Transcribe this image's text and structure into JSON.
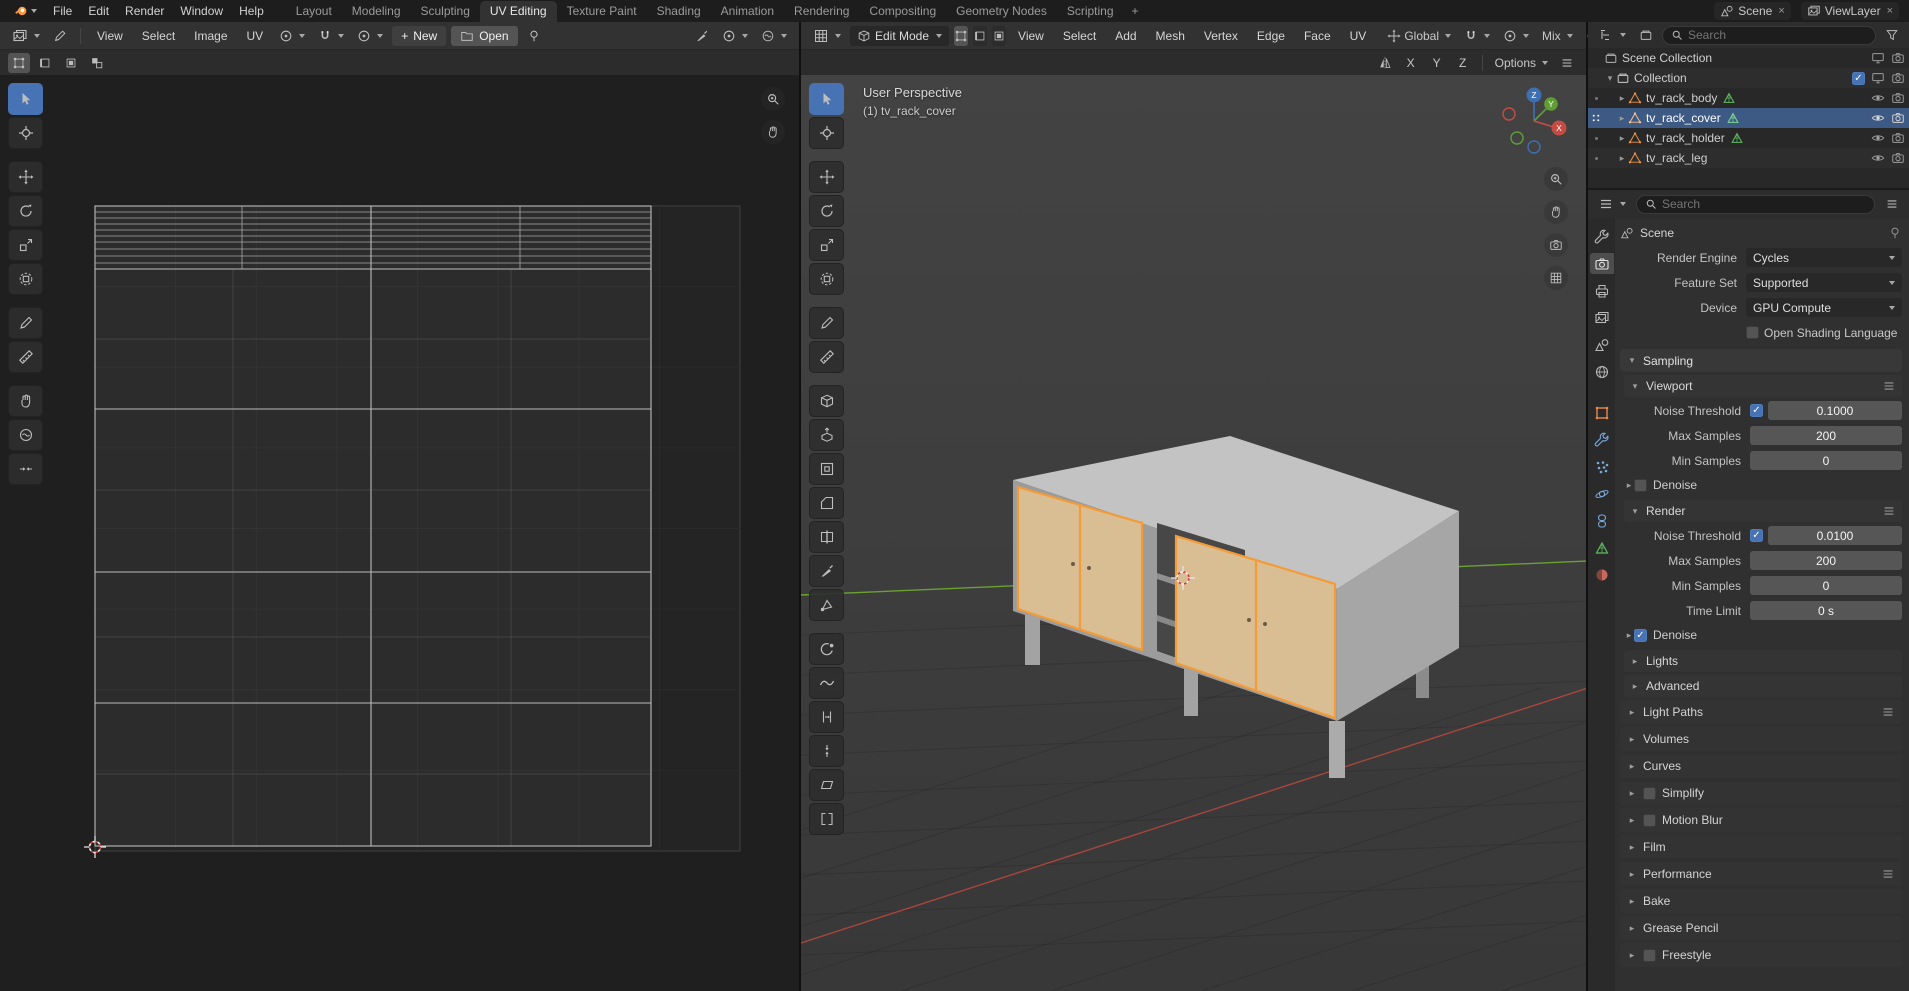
{
  "topbar": {
    "menus": [
      "File",
      "Edit",
      "Render",
      "Window",
      "Help"
    ],
    "tabs": [
      "Layout",
      "Modeling",
      "Sculpting",
      "UV Editing",
      "Texture Paint",
      "Shading",
      "Animation",
      "Rendering",
      "Compositing",
      "Geometry Nodes",
      "Scripting"
    ],
    "add_tab": "+",
    "scene_label": "Scene",
    "viewlayer_label": "ViewLayer",
    "close_glyph": "×"
  },
  "uv": {
    "menus": [
      "View",
      "Select",
      "Image",
      "UV"
    ],
    "new_label": "New",
    "new_plus": "+",
    "open_label": "Open",
    "tools": [
      "tweak-select",
      "cursor",
      "move",
      "rotate",
      "scale",
      "transform",
      "annotate",
      "measure",
      "grab",
      "relax",
      "pinch"
    ]
  },
  "vp": {
    "mode": "Edit Mode",
    "menus": [
      "View",
      "Select",
      "Add",
      "Mesh",
      "Vertex",
      "Edge",
      "Face",
      "UV"
    ],
    "orientation": "Global",
    "falloff": "Mix",
    "mirror_x": "X",
    "mirror_y": "Y",
    "mirror_z": "Z",
    "options": "Options",
    "overlay_line1": "User Perspective",
    "overlay_line2": "(1) tv_rack_cover",
    "gizmo_x": "X",
    "gizmo_y": "Y",
    "gizmo_z": "Z",
    "tools": [
      "tweak-select",
      "cursor",
      "move",
      "rotate",
      "scale",
      "transform",
      "annotate",
      "measure",
      "add-cube",
      "extrude-region",
      "inset-faces",
      "bevel",
      "loop-cut",
      "knife",
      "poly-build",
      "spin",
      "smooth",
      "edge-slide",
      "shrink-fatten",
      "shear",
      "rip-region"
    ]
  },
  "outliner": {
    "search_placeholder": "Search",
    "scene_collection": "Scene Collection",
    "collection": "Collection",
    "objects": [
      {
        "name": "tv_rack_body"
      },
      {
        "name": "tv_rack_cover",
        "active": true
      },
      {
        "name": "tv_rack_holder"
      },
      {
        "name": "tv_rack_leg"
      }
    ]
  },
  "props": {
    "search_placeholder": "Search",
    "breadcrumb": "Scene",
    "render_engine_label": "Render Engine",
    "render_engine_value": "Cycles",
    "feature_set_label": "Feature Set",
    "feature_set_value": "Supported",
    "device_label": "Device",
    "device_value": "GPU Compute",
    "osl_label": "Open Shading Language",
    "sampling_title": "Sampling",
    "viewport_title": "Viewport",
    "vp_noise_label": "Noise Threshold",
    "vp_noise_value": "0.1000",
    "vp_max_label": "Max Samples",
    "vp_max_value": "200",
    "vp_min_label": "Min Samples",
    "vp_min_value": "0",
    "vp_denoise_label": "Denoise",
    "render_title": "Render",
    "r_noise_label": "Noise Threshold",
    "r_noise_value": "0.0100",
    "r_max_label": "Max Samples",
    "r_max_value": "200",
    "r_min_label": "Min Samples",
    "r_min_value": "0",
    "r_time_label": "Time Limit",
    "r_time_value": "0 s",
    "r_denoise_label": "Denoise",
    "lights_label": "Lights",
    "advanced_label": "Advanced",
    "sections": [
      {
        "label": "Light Paths"
      },
      {
        "label": "Volumes"
      },
      {
        "label": "Curves"
      },
      {
        "label": "Simplify"
      },
      {
        "label": "Motion Blur"
      },
      {
        "label": "Film"
      },
      {
        "label": "Performance"
      },
      {
        "label": "Bake"
      },
      {
        "label": "Grease Pencil"
      },
      {
        "label": "Freestyle"
      }
    ]
  },
  "colors": {
    "accent_blue": "#4772b3",
    "selection_orange": "#f49b36",
    "object_icon_orange": "#ef9440",
    "mesh_data_green": "#5fba5f",
    "axis_x_red": "#a8453d",
    "axis_y_green": "#6aa131"
  }
}
